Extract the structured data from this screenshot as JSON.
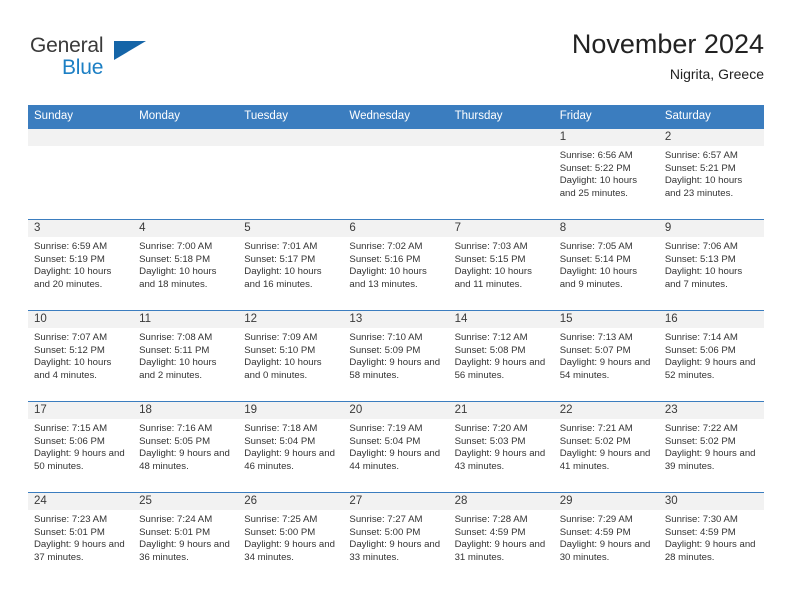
{
  "brand": {
    "name_part1": "General",
    "name_part2": "Blue",
    "logo_icon": "blue-triangle-icon",
    "color_primary": "#1c7fc4",
    "color_triangle": "#1565a8"
  },
  "header": {
    "title": "November 2024",
    "subtitle": "Nigrita, Greece"
  },
  "calendar": {
    "header_bg": "#3b7dbf",
    "daynum_bg": "#f2f2f2",
    "weekdays": [
      "Sunday",
      "Monday",
      "Tuesday",
      "Wednesday",
      "Thursday",
      "Friday",
      "Saturday"
    ],
    "weeks": [
      [
        {
          "day": "",
          "sunrise": "",
          "sunset": "",
          "daylight": "",
          "empty": true
        },
        {
          "day": "",
          "sunrise": "",
          "sunset": "",
          "daylight": "",
          "empty": true
        },
        {
          "day": "",
          "sunrise": "",
          "sunset": "",
          "daylight": "",
          "empty": true
        },
        {
          "day": "",
          "sunrise": "",
          "sunset": "",
          "daylight": "",
          "empty": true
        },
        {
          "day": "",
          "sunrise": "",
          "sunset": "",
          "daylight": "",
          "empty": true
        },
        {
          "day": "1",
          "sunrise": "Sunrise: 6:56 AM",
          "sunset": "Sunset: 5:22 PM",
          "daylight": "Daylight: 10 hours and 25 minutes."
        },
        {
          "day": "2",
          "sunrise": "Sunrise: 6:57 AM",
          "sunset": "Sunset: 5:21 PM",
          "daylight": "Daylight: 10 hours and 23 minutes."
        }
      ],
      [
        {
          "day": "3",
          "sunrise": "Sunrise: 6:59 AM",
          "sunset": "Sunset: 5:19 PM",
          "daylight": "Daylight: 10 hours and 20 minutes."
        },
        {
          "day": "4",
          "sunrise": "Sunrise: 7:00 AM",
          "sunset": "Sunset: 5:18 PM",
          "daylight": "Daylight: 10 hours and 18 minutes."
        },
        {
          "day": "5",
          "sunrise": "Sunrise: 7:01 AM",
          "sunset": "Sunset: 5:17 PM",
          "daylight": "Daylight: 10 hours and 16 minutes."
        },
        {
          "day": "6",
          "sunrise": "Sunrise: 7:02 AM",
          "sunset": "Sunset: 5:16 PM",
          "daylight": "Daylight: 10 hours and 13 minutes."
        },
        {
          "day": "7",
          "sunrise": "Sunrise: 7:03 AM",
          "sunset": "Sunset: 5:15 PM",
          "daylight": "Daylight: 10 hours and 11 minutes."
        },
        {
          "day": "8",
          "sunrise": "Sunrise: 7:05 AM",
          "sunset": "Sunset: 5:14 PM",
          "daylight": "Daylight: 10 hours and 9 minutes."
        },
        {
          "day": "9",
          "sunrise": "Sunrise: 7:06 AM",
          "sunset": "Sunset: 5:13 PM",
          "daylight": "Daylight: 10 hours and 7 minutes."
        }
      ],
      [
        {
          "day": "10",
          "sunrise": "Sunrise: 7:07 AM",
          "sunset": "Sunset: 5:12 PM",
          "daylight": "Daylight: 10 hours and 4 minutes."
        },
        {
          "day": "11",
          "sunrise": "Sunrise: 7:08 AM",
          "sunset": "Sunset: 5:11 PM",
          "daylight": "Daylight: 10 hours and 2 minutes."
        },
        {
          "day": "12",
          "sunrise": "Sunrise: 7:09 AM",
          "sunset": "Sunset: 5:10 PM",
          "daylight": "Daylight: 10 hours and 0 minutes."
        },
        {
          "day": "13",
          "sunrise": "Sunrise: 7:10 AM",
          "sunset": "Sunset: 5:09 PM",
          "daylight": "Daylight: 9 hours and 58 minutes."
        },
        {
          "day": "14",
          "sunrise": "Sunrise: 7:12 AM",
          "sunset": "Sunset: 5:08 PM",
          "daylight": "Daylight: 9 hours and 56 minutes."
        },
        {
          "day": "15",
          "sunrise": "Sunrise: 7:13 AM",
          "sunset": "Sunset: 5:07 PM",
          "daylight": "Daylight: 9 hours and 54 minutes."
        },
        {
          "day": "16",
          "sunrise": "Sunrise: 7:14 AM",
          "sunset": "Sunset: 5:06 PM",
          "daylight": "Daylight: 9 hours and 52 minutes."
        }
      ],
      [
        {
          "day": "17",
          "sunrise": "Sunrise: 7:15 AM",
          "sunset": "Sunset: 5:06 PM",
          "daylight": "Daylight: 9 hours and 50 minutes."
        },
        {
          "day": "18",
          "sunrise": "Sunrise: 7:16 AM",
          "sunset": "Sunset: 5:05 PM",
          "daylight": "Daylight: 9 hours and 48 minutes."
        },
        {
          "day": "19",
          "sunrise": "Sunrise: 7:18 AM",
          "sunset": "Sunset: 5:04 PM",
          "daylight": "Daylight: 9 hours and 46 minutes."
        },
        {
          "day": "20",
          "sunrise": "Sunrise: 7:19 AM",
          "sunset": "Sunset: 5:04 PM",
          "daylight": "Daylight: 9 hours and 44 minutes."
        },
        {
          "day": "21",
          "sunrise": "Sunrise: 7:20 AM",
          "sunset": "Sunset: 5:03 PM",
          "daylight": "Daylight: 9 hours and 43 minutes."
        },
        {
          "day": "22",
          "sunrise": "Sunrise: 7:21 AM",
          "sunset": "Sunset: 5:02 PM",
          "daylight": "Daylight: 9 hours and 41 minutes."
        },
        {
          "day": "23",
          "sunrise": "Sunrise: 7:22 AM",
          "sunset": "Sunset: 5:02 PM",
          "daylight": "Daylight: 9 hours and 39 minutes."
        }
      ],
      [
        {
          "day": "24",
          "sunrise": "Sunrise: 7:23 AM",
          "sunset": "Sunset: 5:01 PM",
          "daylight": "Daylight: 9 hours and 37 minutes."
        },
        {
          "day": "25",
          "sunrise": "Sunrise: 7:24 AM",
          "sunset": "Sunset: 5:01 PM",
          "daylight": "Daylight: 9 hours and 36 minutes."
        },
        {
          "day": "26",
          "sunrise": "Sunrise: 7:25 AM",
          "sunset": "Sunset: 5:00 PM",
          "daylight": "Daylight: 9 hours and 34 minutes."
        },
        {
          "day": "27",
          "sunrise": "Sunrise: 7:27 AM",
          "sunset": "Sunset: 5:00 PM",
          "daylight": "Daylight: 9 hours and 33 minutes."
        },
        {
          "day": "28",
          "sunrise": "Sunrise: 7:28 AM",
          "sunset": "Sunset: 4:59 PM",
          "daylight": "Daylight: 9 hours and 31 minutes."
        },
        {
          "day": "29",
          "sunrise": "Sunrise: 7:29 AM",
          "sunset": "Sunset: 4:59 PM",
          "daylight": "Daylight: 9 hours and 30 minutes."
        },
        {
          "day": "30",
          "sunrise": "Sunrise: 7:30 AM",
          "sunset": "Sunset: 4:59 PM",
          "daylight": "Daylight: 9 hours and 28 minutes."
        }
      ]
    ]
  }
}
